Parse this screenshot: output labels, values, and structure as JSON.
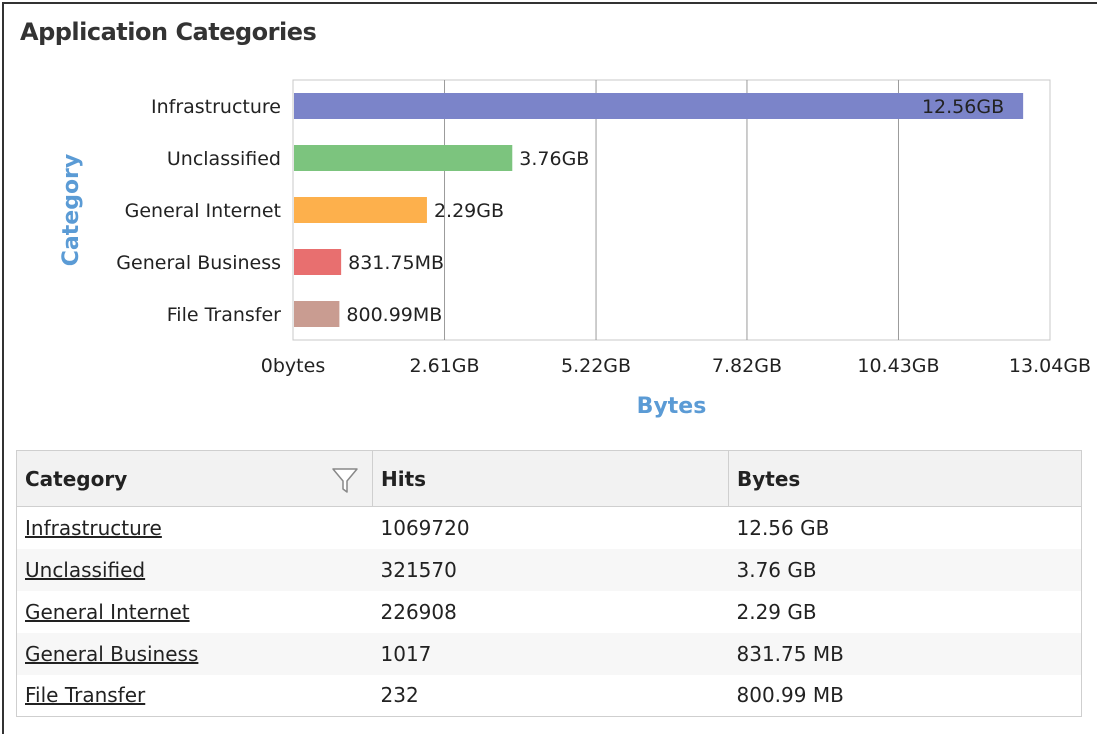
{
  "panel": {
    "title": "Application Categories"
  },
  "chart_data": {
    "type": "bar",
    "orientation": "horizontal",
    "categories": [
      "Infrastructure",
      "Unclassified",
      "General Internet",
      "General Business",
      "File Transfer"
    ],
    "values": [
      12.56,
      3.76,
      2.29,
      0.812,
      0.782
    ],
    "value_labels": [
      "12.56GB",
      "3.76GB",
      "2.29GB",
      "831.75MB",
      "800.99MB"
    ],
    "unit": "GB",
    "colors": [
      "#7b84c9",
      "#7cc47e",
      "#fdb04c",
      "#e86f6f",
      "#c99c91"
    ],
    "xlabel": "Bytes",
    "ylabel": "Category",
    "xlim": [
      0,
      13.04
    ],
    "xticks": [
      0,
      2.61,
      5.22,
      7.82,
      10.43,
      13.04
    ],
    "xtick_labels": [
      "0bytes",
      "2.61GB",
      "5.22GB",
      "7.82GB",
      "10.43GB",
      "13.04GB"
    ],
    "grid": true,
    "legend": "none"
  },
  "table": {
    "headers": {
      "category": "Category",
      "hits": "Hits",
      "bytes": "Bytes"
    },
    "rows": [
      {
        "category": "Infrastructure",
        "hits": "1069720",
        "bytes": "12.56 GB"
      },
      {
        "category": "Unclassified",
        "hits": "321570",
        "bytes": "3.76 GB"
      },
      {
        "category": "General Internet",
        "hits": "226908",
        "bytes": "2.29 GB"
      },
      {
        "category": "General Business",
        "hits": "1017",
        "bytes": "831.75 MB"
      },
      {
        "category": "File Transfer",
        "hits": "232",
        "bytes": "800.99 MB"
      }
    ],
    "filter_icon": "filter-icon"
  }
}
